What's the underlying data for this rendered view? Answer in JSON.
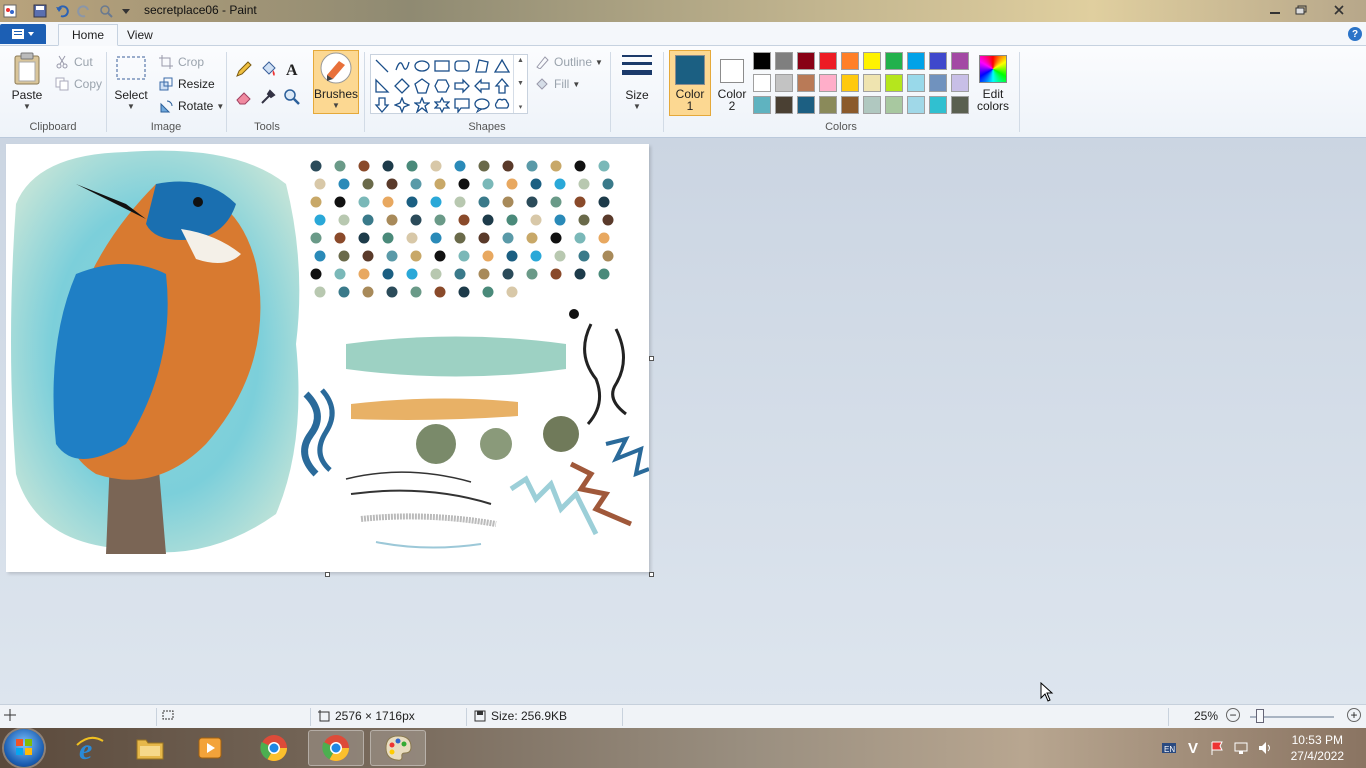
{
  "window": {
    "title": "secretplace06 - Paint",
    "minimize_icon": "minimize-icon",
    "maximize_icon": "maximize-icon",
    "close_icon": "close-icon"
  },
  "tabs": [
    {
      "label": "Home",
      "active": true
    },
    {
      "label": "View",
      "active": false
    }
  ],
  "clipboard": {
    "group_label": "Clipboard",
    "paste_label": "Paste",
    "cut_label": "Cut",
    "copy_label": "Copy"
  },
  "image": {
    "group_label": "Image",
    "select_label": "Select",
    "crop_label": "Crop",
    "resize_label": "Resize",
    "rotate_label": "Rotate"
  },
  "tools": {
    "group_label": "Tools",
    "brushes_label": "Brushes"
  },
  "shapes": {
    "group_label": "Shapes",
    "outline_label": "Outline",
    "fill_label": "Fill",
    "size_label": "Size"
  },
  "colors": {
    "group_label": "Colors",
    "color1_line1": "Color",
    "color1_line2": "1",
    "color2_line1": "Color",
    "color2_line2": "2",
    "color1_value": "#1b5f82",
    "color2_value": "#ffffff",
    "edit_line1": "Edit",
    "edit_line2": "colors",
    "palette": [
      "#000000",
      "#7f7f7f",
      "#880015",
      "#ed1c24",
      "#ff7f27",
      "#fff200",
      "#22b14c",
      "#00a2e8",
      "#3f48cc",
      "#a349a4",
      "#ffffff",
      "#c3c3c3",
      "#b97a57",
      "#ffaec9",
      "#ffc90e",
      "#efe4b0",
      "#b5e61d",
      "#99d9ea",
      "#7092be",
      "#c8bfe7",
      "#5fb3c0",
      "#4a4033",
      "#1c5f82",
      "#8a8a5a",
      "#8b5a2b",
      "#b0c8c0",
      "#a8c8a0",
      "#a0d8e8",
      "#30c0d0",
      "#5a6050"
    ]
  },
  "status": {
    "dimensions": "2576 × 1716px",
    "size": "Size: 256.9KB",
    "zoom": "25%"
  },
  "taskbar": {
    "time": "10:53 PM",
    "date": "27/4/2022"
  }
}
